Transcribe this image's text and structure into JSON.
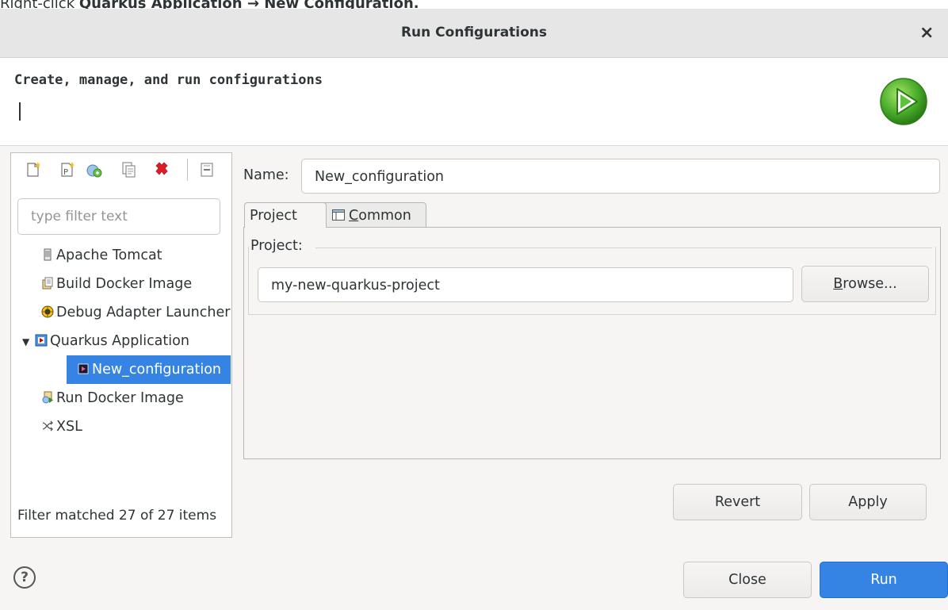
{
  "caption": {
    "prefix": "Right-click ",
    "target": "Quarkus Application",
    "arrow": " → ",
    "action": "New Configuration."
  },
  "window": {
    "title": "Run Configurations",
    "close_glyph": "×"
  },
  "header": {
    "title": "Create, manage, and run configurations"
  },
  "toolbar": {
    "icons": [
      "new-launch-configuration-icon",
      "new-prototype-icon",
      "export-icon",
      "duplicate-icon",
      "delete-icon",
      "collapse-all-icon"
    ]
  },
  "filter": {
    "placeholder": "type filter text",
    "status": "Filter matched 27 of 27 items"
  },
  "tree": {
    "items": [
      {
        "label": "Apache Tomcat",
        "icon": "tomcat-icon"
      },
      {
        "label": "Build Docker Image",
        "icon": "docker-build-icon"
      },
      {
        "label": "Debug Adapter Launcher",
        "icon": "debug-adapter-icon"
      },
      {
        "label": "Quarkus Application",
        "icon": "quarkus-icon",
        "expanded": true
      },
      {
        "label": "New_configuration",
        "icon": "quarkus-config-icon",
        "selected": true
      },
      {
        "label": "Run Docker Image",
        "icon": "docker-run-icon"
      },
      {
        "label": "XSL",
        "icon": "xsl-icon"
      }
    ]
  },
  "config": {
    "name_label": "Name:",
    "name_value": "New_configuration",
    "tabs": [
      {
        "label": "Project",
        "active": true
      },
      {
        "label": "Common",
        "mnemonic": "C",
        "rest": "ommon",
        "icon": "common-tab-icon"
      }
    ],
    "project_group_label": "Project:",
    "project_value": "my-new-quarkus-project",
    "browse": {
      "mnemonic": "B",
      "rest": "rowse..."
    }
  },
  "buttons": {
    "revert": "Revert",
    "apply": "Apply",
    "close": "Close",
    "run": "Run"
  },
  "help": {
    "glyph": "?"
  },
  "colors": {
    "accent": "#3584e4",
    "delete": "#e01b24",
    "selection": "#3584e4"
  }
}
